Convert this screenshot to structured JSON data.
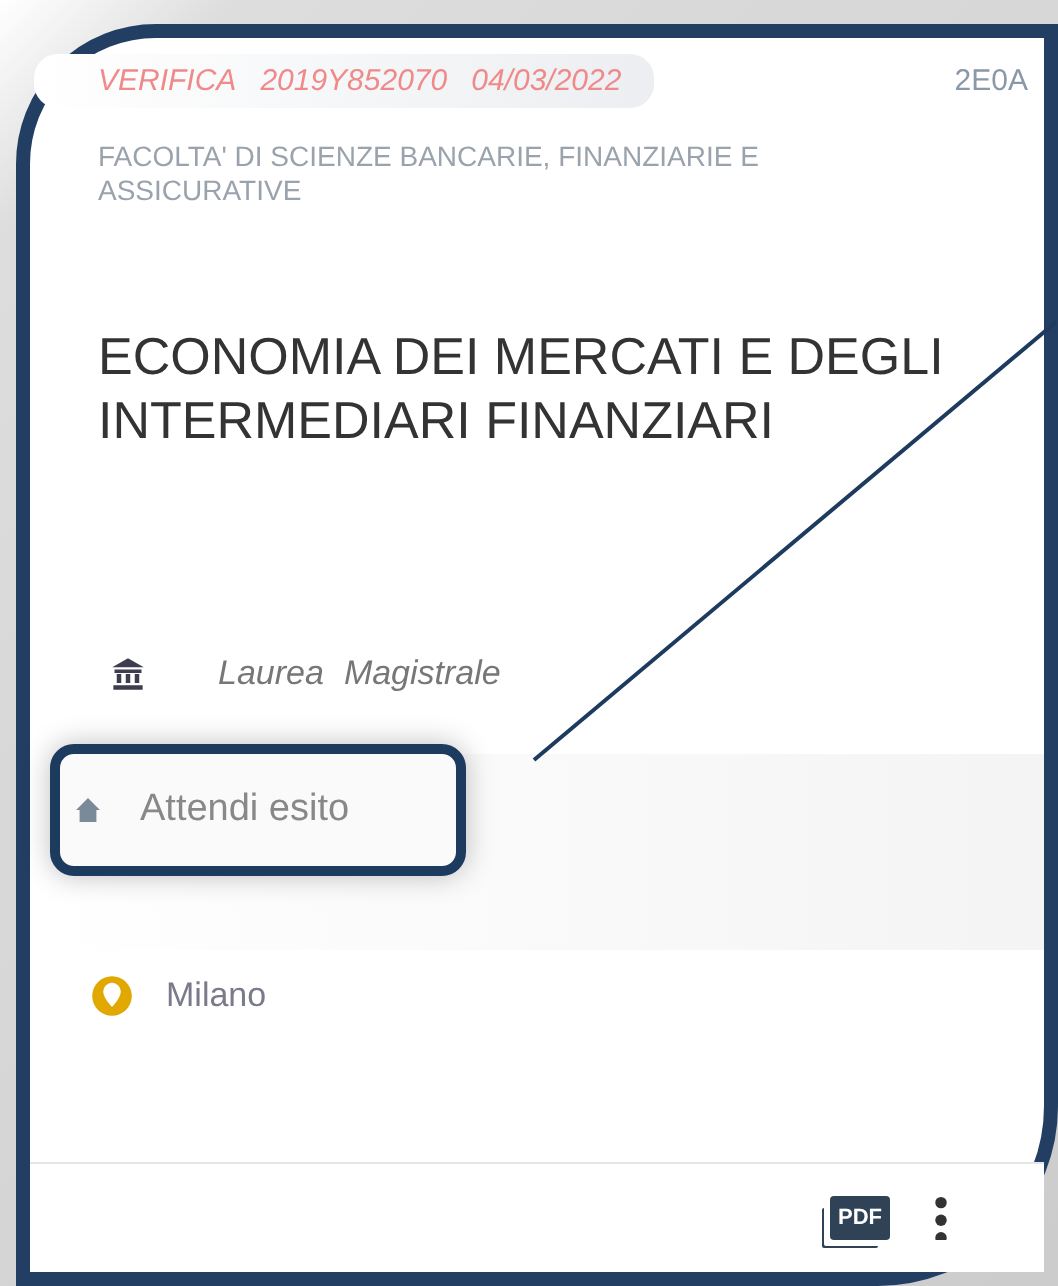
{
  "header": {
    "status": "VERIFICA",
    "code": "2019Y852070",
    "date": "04/03/2022",
    "tag": "2E0A"
  },
  "faculty": "FACOLTA' DI SCIENZE BANCARIE, FINANZIARIE E ASSICURATIVE",
  "title": "ECONOMIA DEI MERCATI E DEGLI INTERMEDIARI FINANZIARI",
  "degree": {
    "type": "Laurea",
    "level": "Magistrale"
  },
  "status": "Attendi esito",
  "location": "Milano",
  "footer": {
    "pdf": "PDF"
  }
}
